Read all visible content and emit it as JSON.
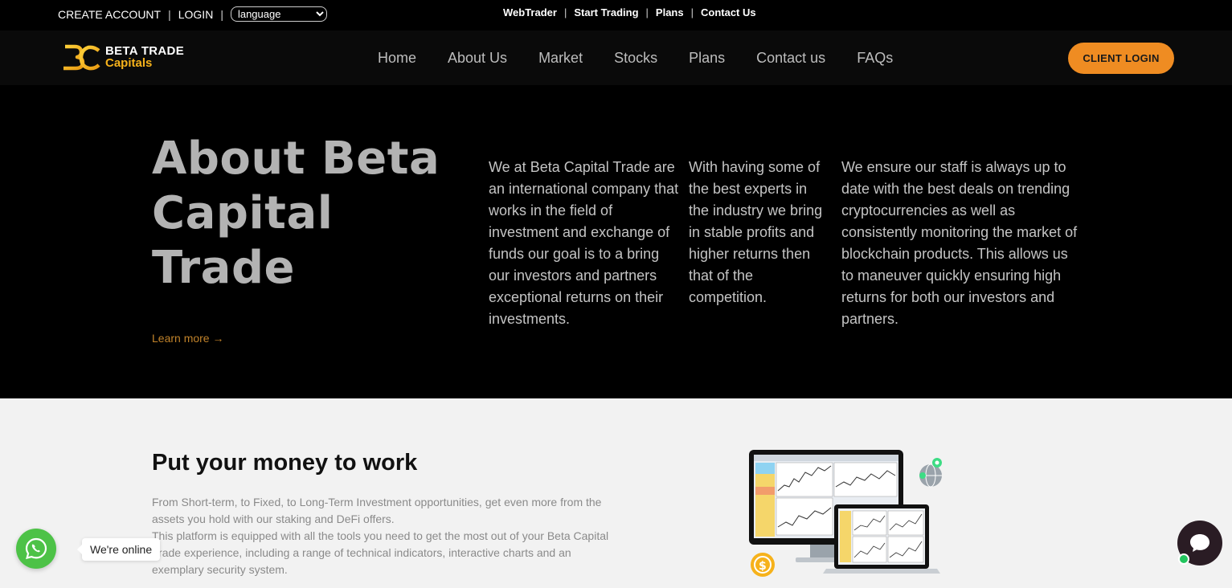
{
  "topbar": {
    "create_account": "CREATE ACCOUNT",
    "login": "LOGIN",
    "separator": "|",
    "language_selected": "language",
    "links": [
      "WebTrader",
      "Start Trading",
      "Plans",
      "Contact Us"
    ]
  },
  "brand": {
    "line1": "BETA TRADE",
    "line2": "Capitals",
    "accent_color": "#f6b21b"
  },
  "nav": {
    "items": [
      "Home",
      "About Us",
      "Market",
      "Stocks",
      "Plans",
      "Contact us",
      "FAQs"
    ],
    "client_login": "CLIENT LOGIN",
    "button_color": "#ef8c22"
  },
  "hero": {
    "title": "About Beta Capital Trade",
    "learn_more": "Learn more →",
    "col1": "We at Beta Capital Trade are an international company that works in the field of investment and exchange of funds our goal is to a bring our investors and partners exceptional returns on their investments.",
    "col2": "With having some of the best experts in the industry we bring in stable profits and higher returns then that of the competition.",
    "col3": "We ensure our staff is always up to date with the best deals on trending cryptocurrencies as well as consistently monitoring the market of blockchain products. This allows us to maneuver quickly ensuring high returns for both our investors and partners."
  },
  "work": {
    "title": "Put your money to work",
    "p1": "From Short-term, to Fixed, to Long-Term Investment opportunities, get even more from the assets you hold with our staking and DeFi offers.",
    "p2": "This platform is equipped with all the tools you need to get the most out of your Beta Capital Trade experience, including a range of technical indicators, interactive charts and an exemplary security system."
  },
  "widgets": {
    "whatsapp_label": "We're online",
    "whatsapp_color": "#4dc247",
    "chat_color": "#2a1c24"
  }
}
